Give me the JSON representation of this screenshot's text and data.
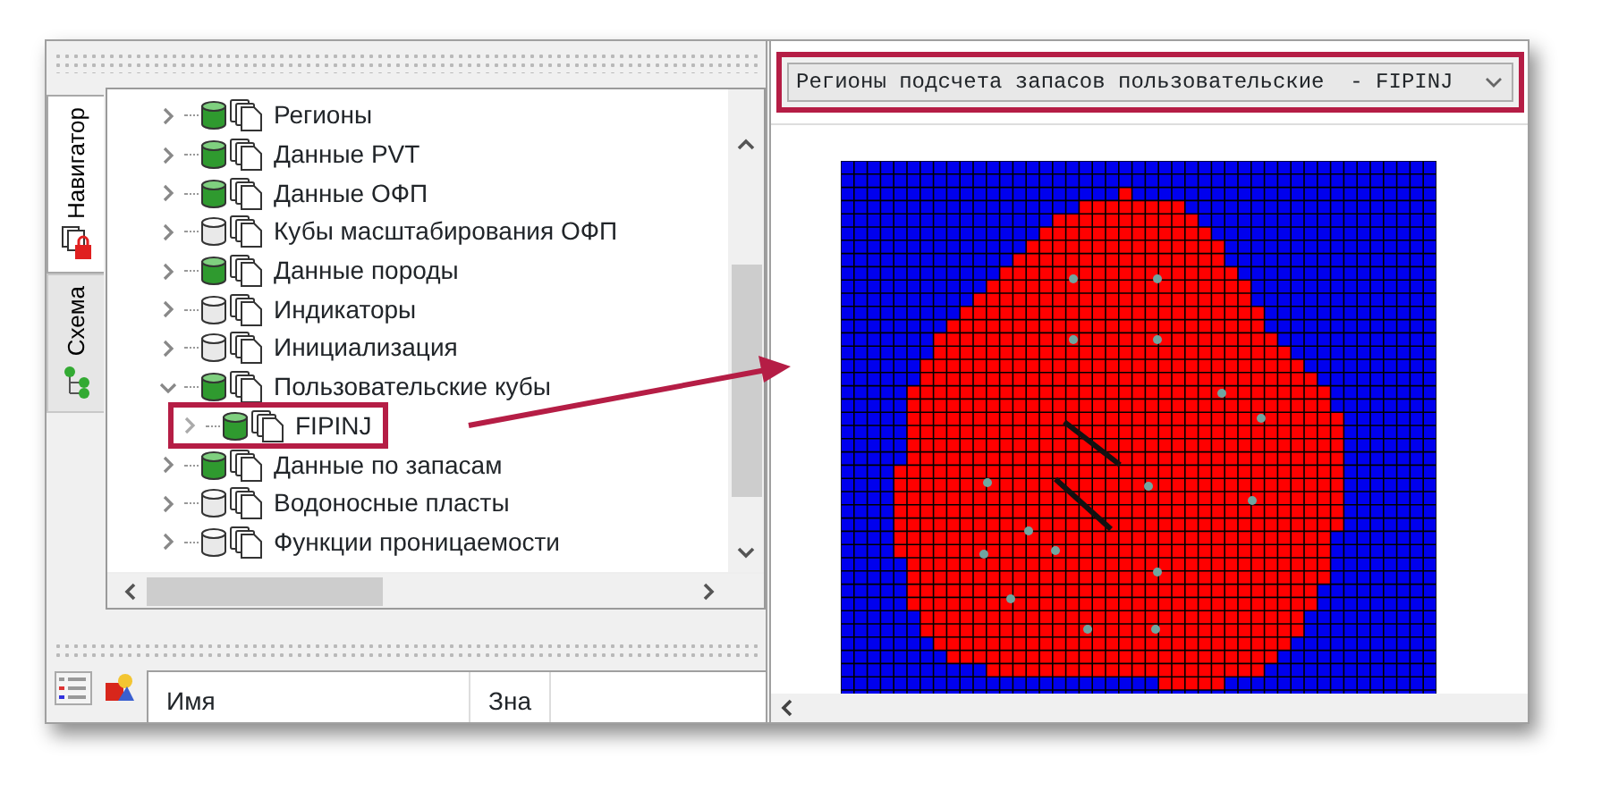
{
  "navigator": {
    "tabs": [
      {
        "label": "Навигатор",
        "selected": true
      },
      {
        "label": "Схема",
        "selected": false
      }
    ],
    "tree": [
      {
        "label": "Регионы",
        "expanded": false,
        "populated": true
      },
      {
        "label": "Данные PVT",
        "expanded": false,
        "populated": true
      },
      {
        "label": "Данные ОФП",
        "expanded": false,
        "populated": true
      },
      {
        "label": "Кубы масштабирования ОФП",
        "expanded": false,
        "populated": false
      },
      {
        "label": "Данные породы",
        "expanded": false,
        "populated": true
      },
      {
        "label": "Индикаторы",
        "expanded": false,
        "populated": false
      },
      {
        "label": "Инициализация",
        "expanded": false,
        "populated": false
      },
      {
        "label": "Пользовательские кубы",
        "expanded": true,
        "populated": true,
        "children": [
          {
            "label": "FIPINJ",
            "expanded": false,
            "populated": true,
            "callout": true
          }
        ]
      },
      {
        "label": "Данные по запасам",
        "expanded": false,
        "populated": true
      },
      {
        "label": "Водоносные пласты",
        "expanded": false,
        "populated": false
      },
      {
        "label": "Функции проницаемости",
        "expanded": false,
        "populated": false
      }
    ]
  },
  "bottom_panel": {
    "columns": [
      "Имя",
      "Зна"
    ]
  },
  "region_selector": {
    "value": "Регионы подсчета запасов пользовательские  - FIPINJ",
    "callout": true
  }
}
